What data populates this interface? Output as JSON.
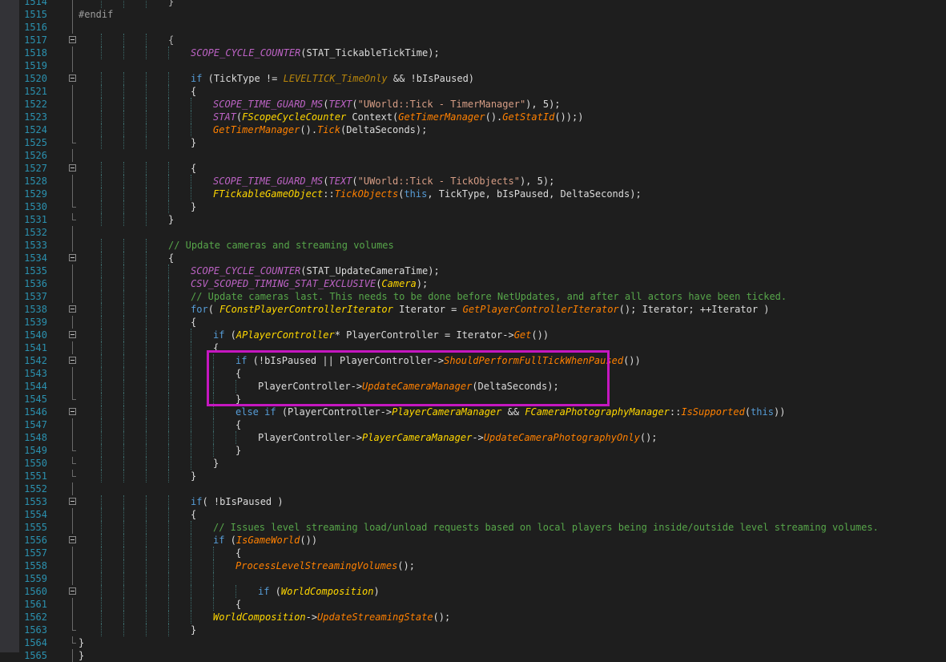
{
  "editor": {
    "language": "C++",
    "highlight_color": "#c517c0",
    "lines": [
      {
        "n": "1514",
        "fold": "line",
        "tokens": [
          {
            "t": "}",
            "c": "op"
          }
        ]
      },
      {
        "n": "1515",
        "fold": "line",
        "tokens": [
          {
            "t": "#endif",
            "c": "pp"
          }
        ]
      },
      {
        "n": "1516",
        "fold": "line",
        "tokens": []
      },
      {
        "n": "1517",
        "fold": "box",
        "tokens": [
          {
            "t": "{",
            "c": "op"
          }
        ]
      },
      {
        "n": "1518",
        "fold": "line",
        "tokens": [
          {
            "t": "SCOPE_CYCLE_COUNTER",
            "c": "mac"
          },
          {
            "t": "(STAT_TickableTickTime);",
            "c": ""
          }
        ]
      },
      {
        "n": "1519",
        "fold": "line",
        "tokens": []
      },
      {
        "n": "1520",
        "fold": "box",
        "tokens": [
          {
            "t": "if",
            "c": "kw"
          },
          {
            "t": " (TickType != ",
            "c": ""
          },
          {
            "t": "LEVELTICK_TimeOnly",
            "c": "en"
          },
          {
            "t": " && !bIsPaused)",
            "c": ""
          }
        ]
      },
      {
        "n": "1521",
        "fold": "line",
        "tokens": [
          {
            "t": "{",
            "c": ""
          }
        ]
      },
      {
        "n": "1522",
        "fold": "line",
        "tokens": [
          {
            "t": "SCOPE_TIME_GUARD_MS",
            "c": "mac"
          },
          {
            "t": "(",
            "c": ""
          },
          {
            "t": "TEXT",
            "c": "mac"
          },
          {
            "t": "(",
            "c": ""
          },
          {
            "t": "\"UWorld::Tick - TimerManager\"",
            "c": "str"
          },
          {
            "t": "), 5);",
            "c": ""
          }
        ]
      },
      {
        "n": "1523",
        "fold": "line",
        "tokens": [
          {
            "t": "STAT",
            "c": "mac"
          },
          {
            "t": "(",
            "c": ""
          },
          {
            "t": "FScopeCycleCounter",
            "c": "ty"
          },
          {
            "t": " Context(",
            "c": ""
          },
          {
            "t": "GetTimerManager",
            "c": "fn"
          },
          {
            "t": "().",
            "c": ""
          },
          {
            "t": "GetStatId",
            "c": "fn"
          },
          {
            "t": "());)",
            "c": ""
          }
        ]
      },
      {
        "n": "1524",
        "fold": "line",
        "tokens": [
          {
            "t": "GetTimerManager",
            "c": "fn"
          },
          {
            "t": "().",
            "c": ""
          },
          {
            "t": "Tick",
            "c": "fn"
          },
          {
            "t": "(DeltaSeconds);",
            "c": ""
          }
        ]
      },
      {
        "n": "1525",
        "fold": "end",
        "tokens": [
          {
            "t": "}",
            "c": ""
          }
        ]
      },
      {
        "n": "1526",
        "fold": "line",
        "tokens": []
      },
      {
        "n": "1527",
        "fold": "box",
        "tokens": [
          {
            "t": "{",
            "c": ""
          }
        ]
      },
      {
        "n": "1528",
        "fold": "line",
        "tokens": [
          {
            "t": "SCOPE_TIME_GUARD_MS",
            "c": "mac"
          },
          {
            "t": "(",
            "c": ""
          },
          {
            "t": "TEXT",
            "c": "mac"
          },
          {
            "t": "(",
            "c": ""
          },
          {
            "t": "\"UWorld::Tick - TickObjects\"",
            "c": "str"
          },
          {
            "t": "), 5);",
            "c": ""
          }
        ]
      },
      {
        "n": "1529",
        "fold": "line",
        "tokens": [
          {
            "t": "FTickableGameObject",
            "c": "ty"
          },
          {
            "t": "::",
            "c": ""
          },
          {
            "t": "TickObjects",
            "c": "fn"
          },
          {
            "t": "(",
            "c": ""
          },
          {
            "t": "this",
            "c": "kw"
          },
          {
            "t": ", TickType, bIsPaused, DeltaSeconds);",
            "c": ""
          }
        ]
      },
      {
        "n": "1530",
        "fold": "end",
        "tokens": [
          {
            "t": "}",
            "c": ""
          }
        ]
      },
      {
        "n": "1531",
        "fold": "end",
        "tokens": [
          {
            "t": "}",
            "c": ""
          }
        ]
      },
      {
        "n": "1532",
        "fold": "line",
        "tokens": []
      },
      {
        "n": "1533",
        "fold": "line",
        "tokens": [
          {
            "t": "// Update cameras and streaming volumes",
            "c": "cm"
          }
        ]
      },
      {
        "n": "1534",
        "fold": "box",
        "tokens": [
          {
            "t": "{",
            "c": ""
          }
        ]
      },
      {
        "n": "1535",
        "fold": "line",
        "tokens": [
          {
            "t": "SCOPE_CYCLE_COUNTER",
            "c": "mac"
          },
          {
            "t": "(STAT_UpdateCameraTime);",
            "c": ""
          }
        ]
      },
      {
        "n": "1536",
        "fold": "line",
        "tokens": [
          {
            "t": "CSV_SCOPED_TIMING_STAT_EXCLUSIVE",
            "c": "mac"
          },
          {
            "t": "(",
            "c": ""
          },
          {
            "t": "Camera",
            "c": "ty"
          },
          {
            "t": ");",
            "c": ""
          }
        ]
      },
      {
        "n": "1537",
        "fold": "line",
        "tokens": [
          {
            "t": "// Update cameras last. This needs to be done before NetUpdates, and after all actors have been ticked.",
            "c": "cm"
          }
        ]
      },
      {
        "n": "1538",
        "fold": "box",
        "tokens": [
          {
            "t": "for",
            "c": "kw"
          },
          {
            "t": "( ",
            "c": ""
          },
          {
            "t": "FConstPlayerControllerIterator",
            "c": "ty"
          },
          {
            "t": " Iterator = ",
            "c": ""
          },
          {
            "t": "GetPlayerControllerIterator",
            "c": "fn"
          },
          {
            "t": "(); Iterator; ++Iterator )",
            "c": ""
          }
        ]
      },
      {
        "n": "1539",
        "fold": "line",
        "tokens": [
          {
            "t": "{",
            "c": ""
          }
        ]
      },
      {
        "n": "1540",
        "fold": "box",
        "tokens": [
          {
            "t": "if",
            "c": "kw"
          },
          {
            "t": " (",
            "c": ""
          },
          {
            "t": "APlayerController",
            "c": "ty"
          },
          {
            "t": "* PlayerController = Iterator->",
            "c": ""
          },
          {
            "t": "Get",
            "c": "fn"
          },
          {
            "t": "())",
            "c": ""
          }
        ]
      },
      {
        "n": "1541",
        "fold": "line",
        "tokens": [
          {
            "t": "{",
            "c": ""
          }
        ]
      },
      {
        "n": "1542",
        "fold": "box",
        "tokens": [
          {
            "t": "if",
            "c": "kw"
          },
          {
            "t": " (!bIsPaused || PlayerController->",
            "c": ""
          },
          {
            "t": "ShouldPerformFullTickWhenPaused",
            "c": "fn"
          },
          {
            "t": "())",
            "c": ""
          }
        ]
      },
      {
        "n": "1543",
        "fold": "line",
        "tokens": [
          {
            "t": "{",
            "c": ""
          }
        ]
      },
      {
        "n": "1544",
        "fold": "line",
        "tokens": [
          {
            "t": "PlayerController->",
            "c": ""
          },
          {
            "t": "UpdateCameraManager",
            "c": "fn"
          },
          {
            "t": "(DeltaSeconds);",
            "c": ""
          }
        ]
      },
      {
        "n": "1545",
        "fold": "end",
        "tokens": [
          {
            "t": "}",
            "c": ""
          }
        ]
      },
      {
        "n": "1546",
        "fold": "box",
        "tokens": [
          {
            "t": "else",
            "c": "kw"
          },
          {
            "t": " ",
            "c": ""
          },
          {
            "t": "if",
            "c": "kw"
          },
          {
            "t": " (PlayerController->",
            "c": ""
          },
          {
            "t": "PlayerCameraManager",
            "c": "ty"
          },
          {
            "t": " && ",
            "c": ""
          },
          {
            "t": "FCameraPhotographyManager",
            "c": "ty"
          },
          {
            "t": "::",
            "c": ""
          },
          {
            "t": "IsSupported",
            "c": "fn"
          },
          {
            "t": "(",
            "c": ""
          },
          {
            "t": "this",
            "c": "kw"
          },
          {
            "t": "))",
            "c": ""
          }
        ]
      },
      {
        "n": "1547",
        "fold": "line",
        "tokens": [
          {
            "t": "{",
            "c": ""
          }
        ]
      },
      {
        "n": "1548",
        "fold": "line",
        "tokens": [
          {
            "t": "PlayerController->",
            "c": ""
          },
          {
            "t": "PlayerCameraManager",
            "c": "ty"
          },
          {
            "t": "->",
            "c": ""
          },
          {
            "t": "UpdateCameraPhotographyOnly",
            "c": "fn"
          },
          {
            "t": "();",
            "c": ""
          }
        ]
      },
      {
        "n": "1549",
        "fold": "end",
        "tokens": [
          {
            "t": "}",
            "c": ""
          }
        ]
      },
      {
        "n": "1550",
        "fold": "end",
        "tokens": [
          {
            "t": "}",
            "c": ""
          }
        ]
      },
      {
        "n": "1551",
        "fold": "end",
        "tokens": [
          {
            "t": "}",
            "c": ""
          }
        ]
      },
      {
        "n": "1552",
        "fold": "line",
        "tokens": []
      },
      {
        "n": "1553",
        "fold": "box",
        "tokens": [
          {
            "t": "if",
            "c": "kw"
          },
          {
            "t": "( !bIsPaused )",
            "c": ""
          }
        ]
      },
      {
        "n": "1554",
        "fold": "line",
        "tokens": [
          {
            "t": "{",
            "c": ""
          }
        ]
      },
      {
        "n": "1555",
        "fold": "line",
        "tokens": [
          {
            "t": "// Issues level streaming load/unload requests based on local players being inside/outside level streaming volumes.",
            "c": "cm"
          }
        ]
      },
      {
        "n": "1556",
        "fold": "box",
        "tokens": [
          {
            "t": "if",
            "c": "kw"
          },
          {
            "t": " (",
            "c": ""
          },
          {
            "t": "IsGameWorld",
            "c": "fn"
          },
          {
            "t": "())",
            "c": ""
          }
        ]
      },
      {
        "n": "1557",
        "fold": "line",
        "tokens": [
          {
            "t": "{",
            "c": ""
          }
        ]
      },
      {
        "n": "1558",
        "fold": "line",
        "tokens": [
          {
            "t": "ProcessLevelStreamingVolumes",
            "c": "fn"
          },
          {
            "t": "();",
            "c": ""
          }
        ]
      },
      {
        "n": "1559",
        "fold": "line",
        "tokens": []
      },
      {
        "n": "1560",
        "fold": "box",
        "tokens": [
          {
            "t": "if",
            "c": "kw"
          },
          {
            "t": " (",
            "c": ""
          },
          {
            "t": "WorldComposition",
            "c": "ty"
          },
          {
            "t": ")",
            "c": ""
          }
        ]
      },
      {
        "n": "1561",
        "fold": "line",
        "tokens": [
          {
            "t": "{",
            "c": ""
          }
        ]
      },
      {
        "n": "1562",
        "fold": "line",
        "tokens": [
          {
            "t": "WorldComposition",
            "c": "ty"
          },
          {
            "t": "->",
            "c": ""
          },
          {
            "t": "UpdateStreamingState",
            "c": "fn"
          },
          {
            "t": "();",
            "c": ""
          }
        ]
      },
      {
        "n": "1563",
        "fold": "end",
        "tokens": [
          {
            "t": "}",
            "c": ""
          }
        ]
      },
      {
        "n": "1564",
        "fold": "end",
        "tokens": [
          {
            "t": "}",
            "c": ""
          }
        ]
      },
      {
        "n": "1565",
        "fold": "line",
        "tokens": [
          {
            "t": "}",
            "c": ""
          }
        ]
      }
    ]
  }
}
